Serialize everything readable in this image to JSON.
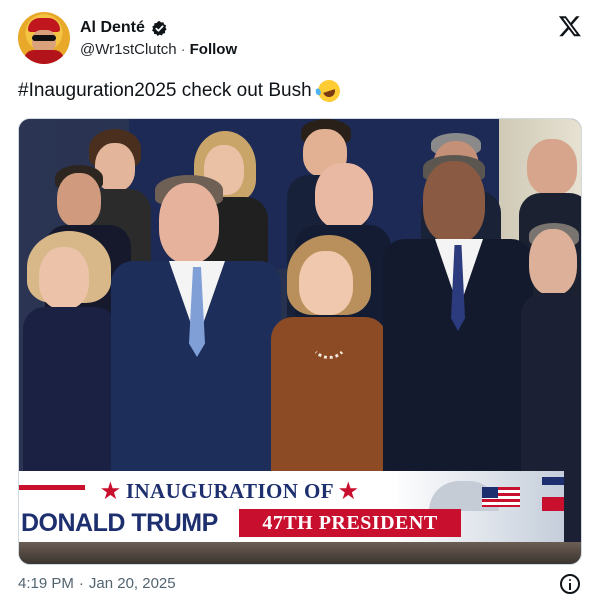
{
  "author": {
    "display_name": "Al Denté",
    "handle": "@Wr1stClutch",
    "follow_label": "Follow",
    "verified": true
  },
  "post": {
    "text": "#Inauguration2025 check out Bush",
    "emoji": "rolling-on-floor-laughing"
  },
  "media": {
    "chyron": {
      "line1_prefix": "★",
      "line1_text": "INAUGURATION OF",
      "line1_suffix": "★",
      "line2_name": "DONALD TRUMP",
      "line2_badge": "47TH PRESIDENT"
    }
  },
  "footer": {
    "time": "4:19 PM",
    "separator": "·",
    "date": "Jan 20, 2025"
  },
  "colors": {
    "chyron_red": "#c8102e",
    "chyron_blue": "#1d2f6e",
    "verified_badge": "#0f1419"
  }
}
